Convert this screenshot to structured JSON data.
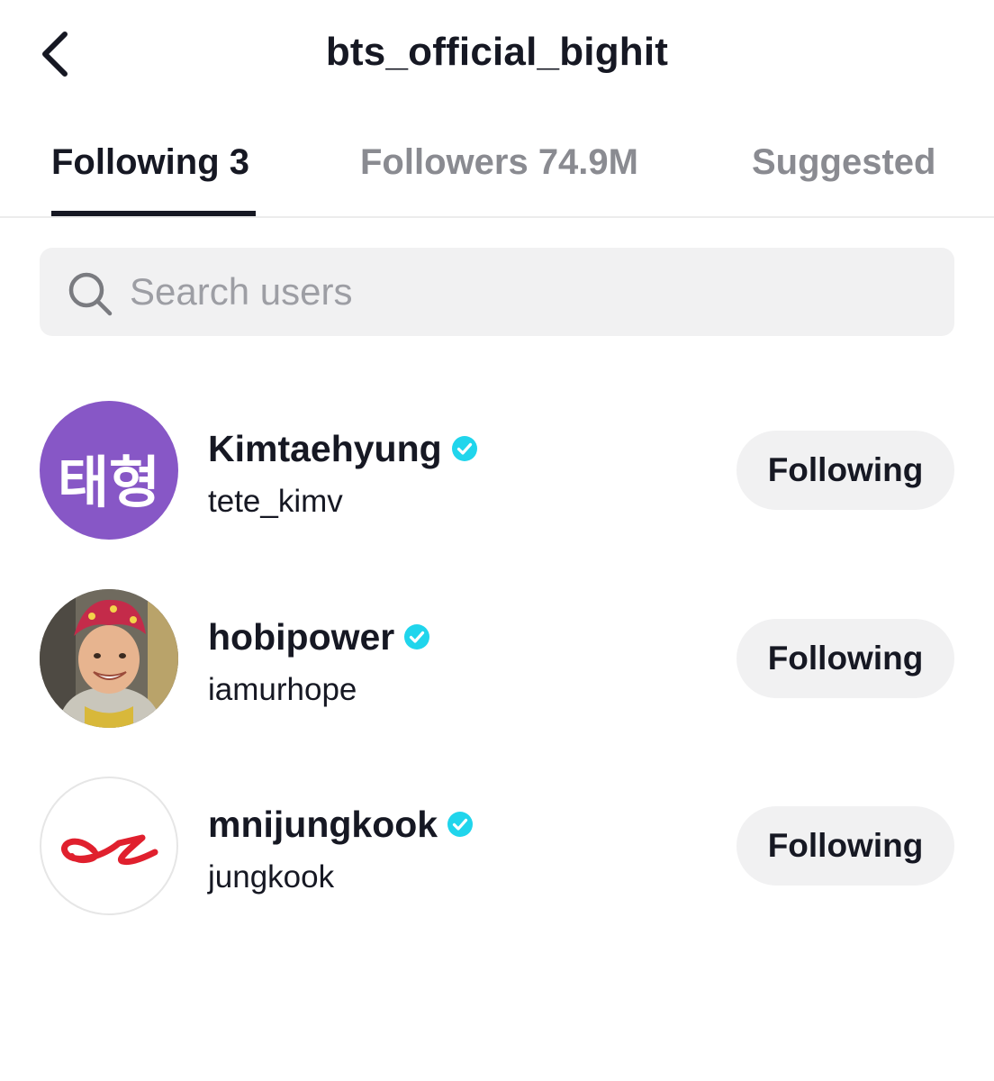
{
  "header": {
    "title": "bts_official_bighit",
    "back_icon": "chevron-left-icon"
  },
  "tabs": [
    {
      "label": "Following 3",
      "active": true
    },
    {
      "label": "Followers 74.9M",
      "active": false
    },
    {
      "label": "Suggested",
      "active": false
    }
  ],
  "search": {
    "placeholder": "Search users",
    "value": "",
    "icon": "search-icon"
  },
  "users": [
    {
      "name": "Kimtaehyung",
      "handle": "tete_kimv",
      "verified": true,
      "avatar_text": "태형",
      "button_label": "Following"
    },
    {
      "name": "hobipower",
      "handle": "iamurhope",
      "verified": true,
      "button_label": "Following"
    },
    {
      "name": "mnijungkook",
      "handle": "jungkook",
      "verified": true,
      "button_label": "Following"
    }
  ],
  "colors": {
    "verified": "#20d5ec",
    "avatar_purple": "#8757c6",
    "logo_red": "#e0202e",
    "button_bg": "#f1f1f2",
    "inactive_tab": "#8a8b91",
    "text": "#161823"
  }
}
